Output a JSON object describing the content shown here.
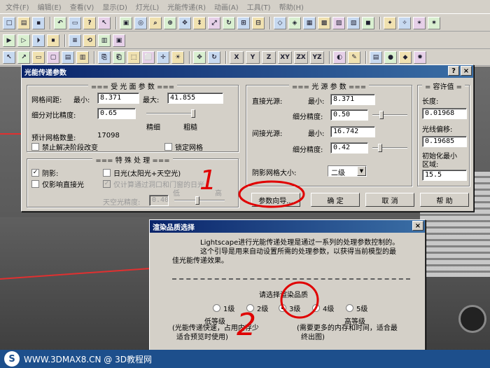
{
  "menubar": {
    "items": [
      "文件(F)",
      "编辑(E)",
      "查看(V)",
      "显示(D)",
      "灯光(L)",
      "光能传递(R)",
      "动画(A)",
      "工具(T)",
      "帮助(H)"
    ]
  },
  "toolbar3_axes": [
    "X",
    "Y",
    "Z",
    "XY",
    "ZX",
    "YZ"
  ],
  "radiosity": {
    "title": "光能传递参数",
    "help_btn": "?",
    "close_btn": "×",
    "receiver": {
      "title": "=== 受 光 面 参 数 ===",
      "mesh_spacing_label": "网格间距:",
      "min_label": "最小:",
      "min_value": "8.371",
      "max_label": "最大:",
      "max_value": "41.855",
      "contrast_label": "细分对比精度:",
      "contrast_value": "0.65",
      "fine_label": "精细",
      "coarse_label": "粗糙",
      "estimate_label": "预计网格数量:",
      "estimate_value": "17098",
      "disable_label": "禁止解决阶段改变",
      "lock_label": "锁定网格"
    },
    "special": {
      "title": "=== 特 殊 处 理 ===",
      "shadow_label": "阴影:",
      "daylight_label": "日光(太阳光+天空光)",
      "direct_only_label": "仅影响直接光",
      "openings_label": "仅计算通过洞口和门窗的日光",
      "low_label": "低",
      "high_label": "高",
      "sky_label": "天空光精度:",
      "sky_value": "0.40"
    },
    "source": {
      "title": "=== 光 源 参 数 ===",
      "direct_label": "直接光源:",
      "direct_min_label": "最小:",
      "direct_min_value": "8.371",
      "direct_sub_label": "细分精度:",
      "direct_sub_value": "0.50",
      "indirect_label": "间接光源:",
      "indirect_min_label": "最小:",
      "indirect_min_value": "16.742",
      "indirect_sub_label": "细分精度:",
      "indirect_sub_value": "0.42",
      "shadow_grid_label": "阴影网格大小:",
      "shadow_grid_value": "二级"
    },
    "tolerance": {
      "title": "= 容许值 =",
      "length_label": "长度:",
      "length_value": "0.01968",
      "offset_label": "光线偏移:",
      "offset_value": "0.19685",
      "init_label_1": "初始化最小",
      "init_label_2": "区域:",
      "init_value": "15.5"
    },
    "buttons": {
      "wizard": "参数向导...",
      "ok": "确 定",
      "cancel": "取 消",
      "help": "帮 助"
    }
  },
  "quality": {
    "title": "渲染品质选择",
    "close_btn": "×",
    "intro": [
      "Lightscape进行光能传递处理是通过一系列的处理参数控制的。",
      "这个引导是用来自动设置所需的处理参数，以获得当前模型的最",
      "佳光能传递效果。"
    ],
    "select_label": "请选择渲染品质",
    "levels": [
      "1级",
      "2级",
      "3级",
      "4级",
      "5级"
    ],
    "selected_index": 2,
    "low_label": "低等级",
    "low_desc_1": "(光能传递快速，占用内存少",
    "low_desc_2": "适合预览时使用)",
    "high_label": "高等级",
    "high_desc_1": "(需要更多的内存和时间，适合最",
    "high_desc_2": "终出图)"
  },
  "annotations": {
    "mark_1": "1",
    "mark_2": "2",
    "color": "#e00000"
  },
  "footer": {
    "logo": "S",
    "text": "WWW.3DMAX8.CN @ 3D教程网"
  }
}
